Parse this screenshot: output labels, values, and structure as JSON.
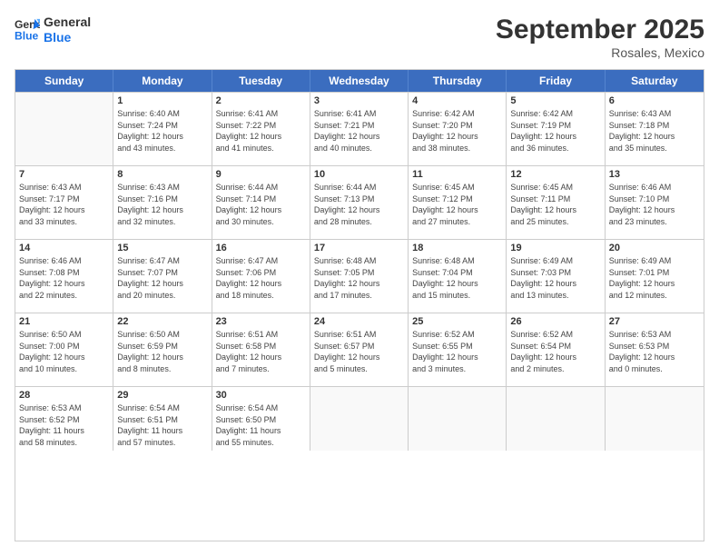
{
  "logo": {
    "line1": "General",
    "line2": "Blue"
  },
  "title": "September 2025",
  "subtitle": "Rosales, Mexico",
  "header_days": [
    "Sunday",
    "Monday",
    "Tuesday",
    "Wednesday",
    "Thursday",
    "Friday",
    "Saturday"
  ],
  "weeks": [
    [
      {
        "day": "",
        "info": ""
      },
      {
        "day": "1",
        "info": "Sunrise: 6:40 AM\nSunset: 7:24 PM\nDaylight: 12 hours\nand 43 minutes."
      },
      {
        "day": "2",
        "info": "Sunrise: 6:41 AM\nSunset: 7:22 PM\nDaylight: 12 hours\nand 41 minutes."
      },
      {
        "day": "3",
        "info": "Sunrise: 6:41 AM\nSunset: 7:21 PM\nDaylight: 12 hours\nand 40 minutes."
      },
      {
        "day": "4",
        "info": "Sunrise: 6:42 AM\nSunset: 7:20 PM\nDaylight: 12 hours\nand 38 minutes."
      },
      {
        "day": "5",
        "info": "Sunrise: 6:42 AM\nSunset: 7:19 PM\nDaylight: 12 hours\nand 36 minutes."
      },
      {
        "day": "6",
        "info": "Sunrise: 6:43 AM\nSunset: 7:18 PM\nDaylight: 12 hours\nand 35 minutes."
      }
    ],
    [
      {
        "day": "7",
        "info": "Sunrise: 6:43 AM\nSunset: 7:17 PM\nDaylight: 12 hours\nand 33 minutes."
      },
      {
        "day": "8",
        "info": "Sunrise: 6:43 AM\nSunset: 7:16 PM\nDaylight: 12 hours\nand 32 minutes."
      },
      {
        "day": "9",
        "info": "Sunrise: 6:44 AM\nSunset: 7:14 PM\nDaylight: 12 hours\nand 30 minutes."
      },
      {
        "day": "10",
        "info": "Sunrise: 6:44 AM\nSunset: 7:13 PM\nDaylight: 12 hours\nand 28 minutes."
      },
      {
        "day": "11",
        "info": "Sunrise: 6:45 AM\nSunset: 7:12 PM\nDaylight: 12 hours\nand 27 minutes."
      },
      {
        "day": "12",
        "info": "Sunrise: 6:45 AM\nSunset: 7:11 PM\nDaylight: 12 hours\nand 25 minutes."
      },
      {
        "day": "13",
        "info": "Sunrise: 6:46 AM\nSunset: 7:10 PM\nDaylight: 12 hours\nand 23 minutes."
      }
    ],
    [
      {
        "day": "14",
        "info": "Sunrise: 6:46 AM\nSunset: 7:08 PM\nDaylight: 12 hours\nand 22 minutes."
      },
      {
        "day": "15",
        "info": "Sunrise: 6:47 AM\nSunset: 7:07 PM\nDaylight: 12 hours\nand 20 minutes."
      },
      {
        "day": "16",
        "info": "Sunrise: 6:47 AM\nSunset: 7:06 PM\nDaylight: 12 hours\nand 18 minutes."
      },
      {
        "day": "17",
        "info": "Sunrise: 6:48 AM\nSunset: 7:05 PM\nDaylight: 12 hours\nand 17 minutes."
      },
      {
        "day": "18",
        "info": "Sunrise: 6:48 AM\nSunset: 7:04 PM\nDaylight: 12 hours\nand 15 minutes."
      },
      {
        "day": "19",
        "info": "Sunrise: 6:49 AM\nSunset: 7:03 PM\nDaylight: 12 hours\nand 13 minutes."
      },
      {
        "day": "20",
        "info": "Sunrise: 6:49 AM\nSunset: 7:01 PM\nDaylight: 12 hours\nand 12 minutes."
      }
    ],
    [
      {
        "day": "21",
        "info": "Sunrise: 6:50 AM\nSunset: 7:00 PM\nDaylight: 12 hours\nand 10 minutes."
      },
      {
        "day": "22",
        "info": "Sunrise: 6:50 AM\nSunset: 6:59 PM\nDaylight: 12 hours\nand 8 minutes."
      },
      {
        "day": "23",
        "info": "Sunrise: 6:51 AM\nSunset: 6:58 PM\nDaylight: 12 hours\nand 7 minutes."
      },
      {
        "day": "24",
        "info": "Sunrise: 6:51 AM\nSunset: 6:57 PM\nDaylight: 12 hours\nand 5 minutes."
      },
      {
        "day": "25",
        "info": "Sunrise: 6:52 AM\nSunset: 6:55 PM\nDaylight: 12 hours\nand 3 minutes."
      },
      {
        "day": "26",
        "info": "Sunrise: 6:52 AM\nSunset: 6:54 PM\nDaylight: 12 hours\nand 2 minutes."
      },
      {
        "day": "27",
        "info": "Sunrise: 6:53 AM\nSunset: 6:53 PM\nDaylight: 12 hours\nand 0 minutes."
      }
    ],
    [
      {
        "day": "28",
        "info": "Sunrise: 6:53 AM\nSunset: 6:52 PM\nDaylight: 11 hours\nand 58 minutes."
      },
      {
        "day": "29",
        "info": "Sunrise: 6:54 AM\nSunset: 6:51 PM\nDaylight: 11 hours\nand 57 minutes."
      },
      {
        "day": "30",
        "info": "Sunrise: 6:54 AM\nSunset: 6:50 PM\nDaylight: 11 hours\nand 55 minutes."
      },
      {
        "day": "",
        "info": ""
      },
      {
        "day": "",
        "info": ""
      },
      {
        "day": "",
        "info": ""
      },
      {
        "day": "",
        "info": ""
      }
    ]
  ]
}
